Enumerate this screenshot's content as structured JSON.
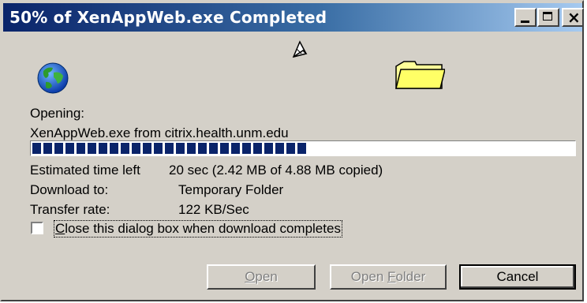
{
  "window": {
    "title": "50% of XenAppWeb.exe Completed",
    "controls": {
      "minimize_icon": "minimize-icon",
      "maximize_icon": "maximize-icon",
      "close_icon": "close-icon",
      "close_glyph": "×"
    }
  },
  "animation": {
    "source_icon": "globe-icon",
    "transfer_icon": "flying-document-icon",
    "destination_icon": "folder-icon"
  },
  "download": {
    "opening_label": "Opening:",
    "source": "XenAppWeb.exe from citrix.health.unm.edu",
    "progress_fraction": 0.5,
    "progress_color": "#0a246a"
  },
  "details": {
    "time_left_label": "Estimated time left",
    "time_left_value": "20 sec (2.42 MB of 4.88 MB copied)",
    "download_to_label": "Download to:",
    "download_to_value": "Temporary Folder",
    "transfer_rate_label": "Transfer rate:",
    "transfer_rate_value": "122 KB/Sec"
  },
  "options": {
    "close_when_done_label": "Close this dialog box when download completes",
    "close_when_done_checked": false
  },
  "buttons": {
    "open": "Open",
    "open_folder": "Open Folder",
    "cancel": "Cancel"
  },
  "colors": {
    "title_gradient_start": "#0a246a",
    "title_gradient_end": "#a6caf0",
    "dialog_face": "#d4d0c8"
  }
}
